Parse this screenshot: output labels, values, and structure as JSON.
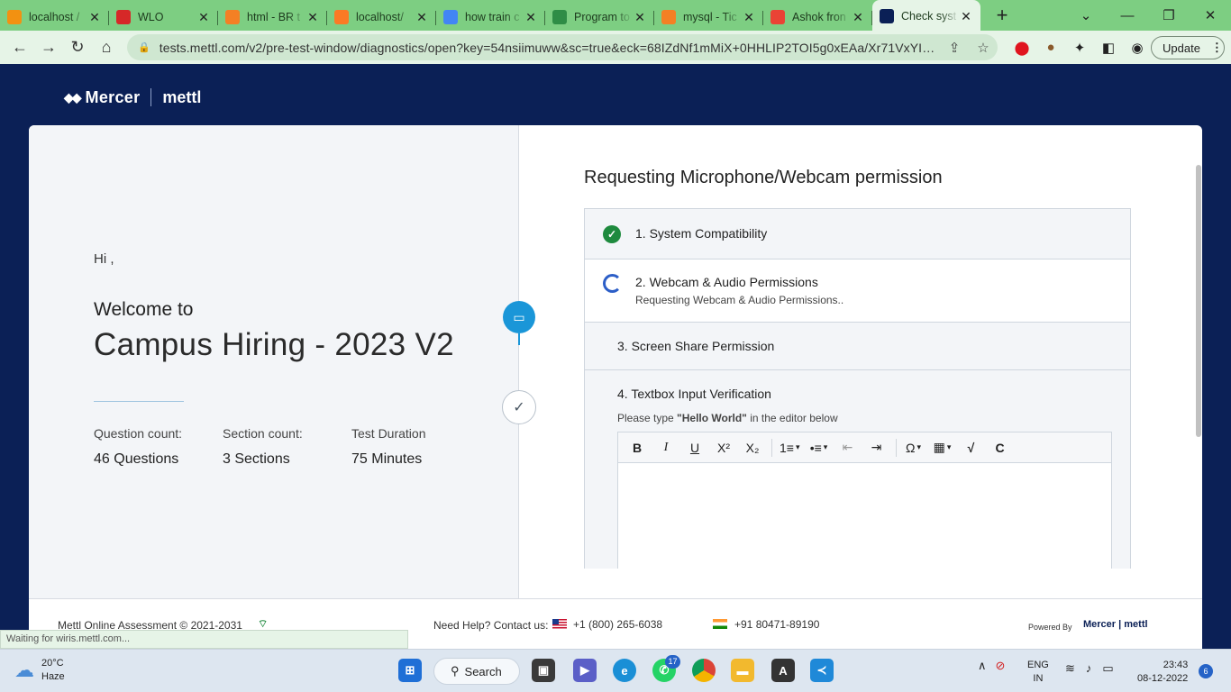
{
  "browser": {
    "tabs": [
      {
        "title": "localhost /",
        "favicon": "phpmyadmin-icon",
        "color": "#f29111"
      },
      {
        "title": "WLO",
        "favicon": "wlo-icon",
        "color": "#d62828"
      },
      {
        "title": "html - BR t",
        "favicon": "stackoverflow-icon",
        "color": "#f48024"
      },
      {
        "title": "localhost/",
        "favicon": "xampp-icon",
        "color": "#fb7a24"
      },
      {
        "title": "how train c",
        "favicon": "google-icon",
        "color": "#4285f4"
      },
      {
        "title": "Program to",
        "favicon": "geeksforgeeks-icon",
        "color": "#2f8d46"
      },
      {
        "title": "mysql - Tic",
        "favicon": "stackoverflow-icon",
        "color": "#f48024"
      },
      {
        "title": "Ashok fron",
        "favicon": "gmail-icon",
        "color": "#ea4335"
      },
      {
        "title": "Check syst",
        "favicon": "mercer-icon",
        "color": "#0b2056",
        "active": true
      }
    ],
    "url": "tests.mettl.com/v2/pre-test-window/diagnostics/open?key=54nsiimuww&sc=true&eck=68IZdNf1mMiX+0HHLIP2TOI5g0xEAa/Xr71VxYIBIf...",
    "update_label": "Update"
  },
  "header": {
    "brand": "Mercer",
    "product": "mettl"
  },
  "left_panel": {
    "greeting": "Hi ,",
    "welcome": "Welcome to",
    "test_name": "Campus Hiring - 2023 V2",
    "stats": [
      {
        "label": "Question count:",
        "value": "46 Questions"
      },
      {
        "label": "Section count:",
        "value": "3 Sections"
      },
      {
        "label": "Test Duration",
        "value": "75  Minutes"
      }
    ]
  },
  "right_panel": {
    "title": "Requesting Microphone/Webcam permission",
    "checks": [
      {
        "label": "1. System Compatibility",
        "status": "done"
      },
      {
        "label": "2. Webcam & Audio Permissions",
        "sub": "Requesting Webcam & Audio Permissions..",
        "status": "in-progress"
      },
      {
        "label": "3. Screen Share Permission",
        "status": "pending"
      },
      {
        "label": "4. Textbox Input Verification",
        "status": "pending"
      }
    ],
    "instruction_prefix": "Please type ",
    "instruction_phrase": "\"Hello World\"",
    "instruction_suffix": " in the editor below",
    "editor_tools": [
      "B",
      "I",
      "U",
      "X²",
      "X₂",
      "1≡",
      "•≡",
      "⇤",
      "⇥",
      "Ω",
      "▦",
      "√",
      "C"
    ]
  },
  "footer": {
    "copyright": "Mettl Online Assessment © 2021-2031",
    "help": "Need Help? Contact us:",
    "phone_us": "+1 (800) 265-6038",
    "phone_in": "+91 80471-89190",
    "powered_by": "Powered By",
    "powered_brand": "Mercer | mettl"
  },
  "status_text": "Waiting for wiris.mettl.com...",
  "taskbar": {
    "weather_temp": "20°C",
    "weather_desc": "Haze",
    "search_label": "Search",
    "whatsapp_badge": "17",
    "lang_top": "ENG",
    "lang_bottom": "IN",
    "time": "23:43",
    "date": "08-12-2022",
    "notifications": "6"
  }
}
